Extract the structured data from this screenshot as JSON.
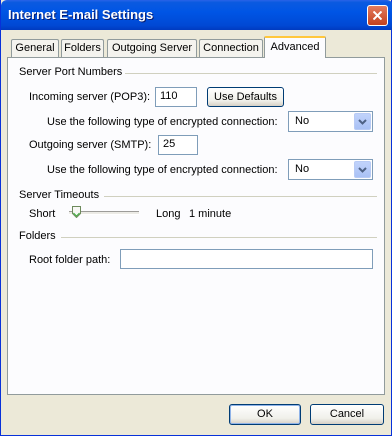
{
  "window": {
    "title": "Internet E-mail Settings"
  },
  "tabs": [
    "General",
    "Folders",
    "Outgoing Server",
    "Connection",
    "Advanced"
  ],
  "active_tab": "Advanced",
  "server_ports": {
    "group_title": "Server Port Numbers",
    "incoming_label": "Incoming server (POP3):",
    "incoming_value": "110",
    "use_defaults_label": "Use Defaults",
    "incoming_encryption_label": "Use the following type of encrypted connection:",
    "incoming_encryption_value": "No",
    "outgoing_label": "Outgoing server (SMTP):",
    "outgoing_value": "25",
    "outgoing_encryption_label": "Use the following type of encrypted connection:",
    "outgoing_encryption_value": "No"
  },
  "timeouts": {
    "group_title": "Server Timeouts",
    "short_label": "Short",
    "long_label": "Long",
    "value_text": "1 minute",
    "slider_level": 0.1
  },
  "folders": {
    "group_title": "Folders",
    "root_label": "Root folder path:",
    "root_value": ""
  },
  "footer": {
    "ok_label": "OK",
    "cancel_label": "Cancel"
  },
  "colors": {
    "titlebar": "#0055e5",
    "dialog_bg": "#ece9d8",
    "panel_bg": "#fcfcfe",
    "tab_highlight": "#ffc73c"
  }
}
